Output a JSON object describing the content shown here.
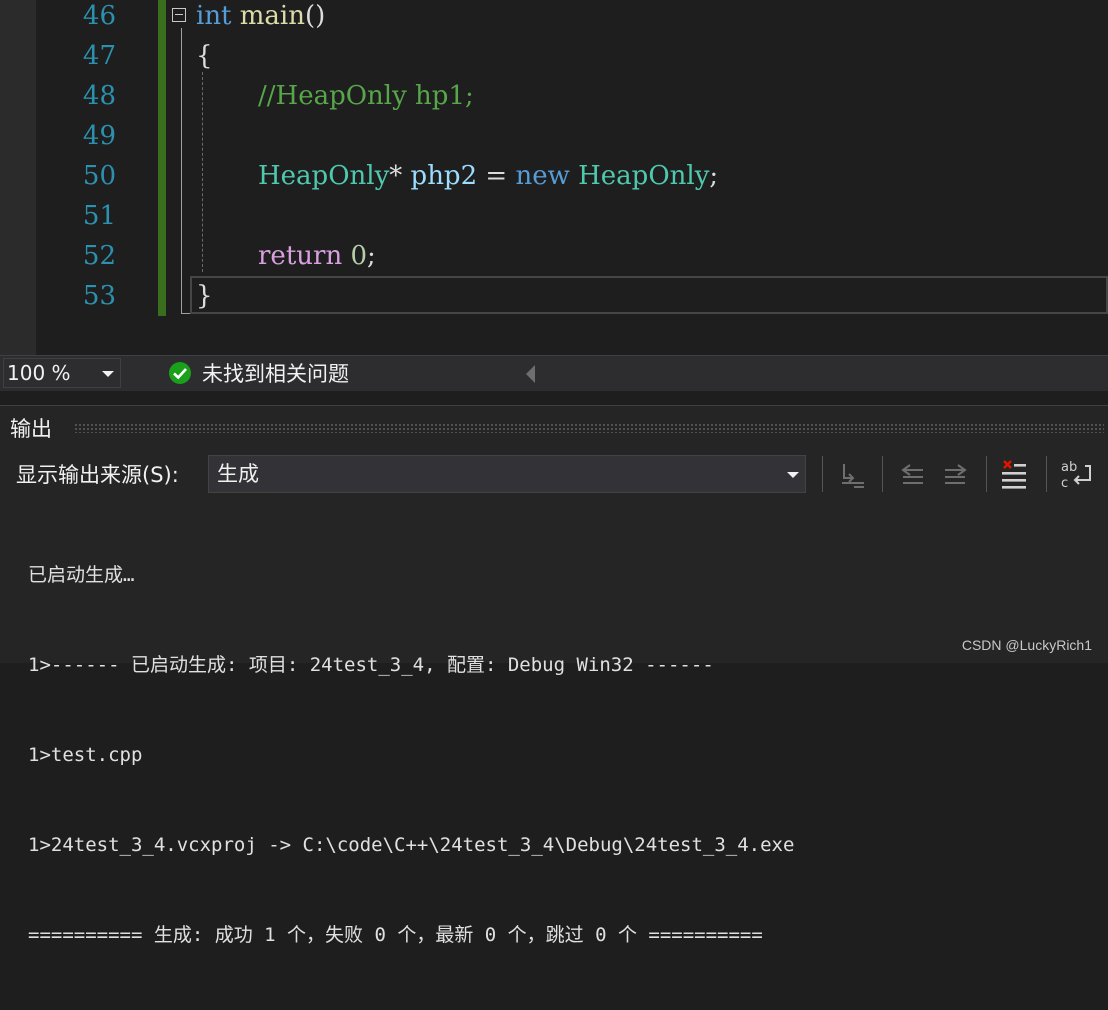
{
  "editor": {
    "line_numbers": [
      "46",
      "47",
      "48",
      "49",
      "50",
      "51",
      "52",
      "53"
    ],
    "lines": {
      "l46": {
        "kw": "int",
        "fn": "main",
        "rest": "()"
      },
      "l47": "{",
      "l48": "//HeapOnly hp1;",
      "l50": {
        "type": "HeapOnly",
        "star": "*",
        "var": "php2",
        "eq": " = ",
        "kw": "new",
        "type2": "HeapOnly",
        "semi": ";"
      },
      "l52": {
        "kw": "return",
        "num": "0",
        "semi": ";"
      },
      "l53": "}"
    }
  },
  "status": {
    "zoom": "100 %",
    "issues": "未找到相关问题"
  },
  "output": {
    "title": "输出",
    "source_label": "显示输出来源(S):",
    "source_value": "生成",
    "lines": [
      "已启动生成…",
      "1>------ 已启动生成: 项目: 24test_3_4, 配置: Debug Win32 ------",
      "1>test.cpp",
      "1>24test_3_4.vcxproj -> C:\\code\\C++\\24test_3_4\\Debug\\24test_3_4.exe",
      "========== 生成: 成功 1 个，失败 0 个，最新 0 个，跳过 0 个 =========="
    ]
  },
  "toolbar_icons": [
    "goto-message-icon",
    "previous-message-icon",
    "next-message-icon",
    "clear-all-icon",
    "word-wrap-icon"
  ],
  "watermark": "CSDN @LuckyRich1",
  "colors": {
    "accent_change_bar": "#3b6d1e",
    "ok_green": "#1ba01b",
    "line_number": "#2b91af"
  }
}
